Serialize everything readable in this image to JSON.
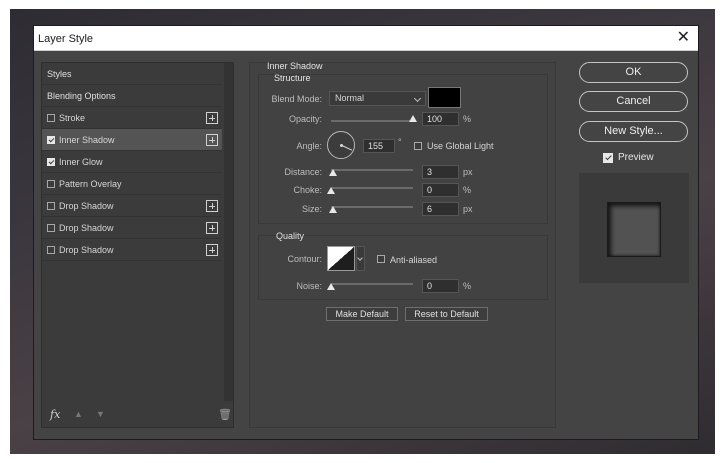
{
  "window": {
    "title": "Layer Style",
    "close_glyph": "✕"
  },
  "styles_list": {
    "items": [
      {
        "label": "Styles",
        "kind": "header",
        "has_checkbox": false,
        "checked": false,
        "has_add": false,
        "selected": false
      },
      {
        "label": "Blending Options",
        "kind": "header",
        "has_checkbox": false,
        "checked": false,
        "has_add": false,
        "selected": false
      },
      {
        "label": "Stroke",
        "kind": "effect",
        "has_checkbox": true,
        "checked": false,
        "has_add": true,
        "selected": false
      },
      {
        "label": "Inner Shadow",
        "kind": "effect",
        "has_checkbox": true,
        "checked": true,
        "has_add": true,
        "selected": true
      },
      {
        "label": "Inner Glow",
        "kind": "effect",
        "has_checkbox": true,
        "checked": true,
        "has_add": false,
        "selected": false
      },
      {
        "label": "Pattern Overlay",
        "kind": "effect",
        "has_checkbox": true,
        "checked": false,
        "has_add": false,
        "selected": false
      },
      {
        "label": "Drop Shadow",
        "kind": "effect",
        "has_checkbox": true,
        "checked": false,
        "has_add": true,
        "selected": false
      },
      {
        "label": "Drop Shadow",
        "kind": "effect",
        "has_checkbox": true,
        "checked": false,
        "has_add": true,
        "selected": false
      },
      {
        "label": "Drop Shadow",
        "kind": "effect",
        "has_checkbox": true,
        "checked": false,
        "has_add": true,
        "selected": false
      }
    ],
    "footer": {
      "fx_label": "fx",
      "move_up_icon": "arrow-up-icon",
      "move_down_icon": "arrow-down-icon",
      "delete_icon": "trash-icon"
    }
  },
  "inner_shadow": {
    "section_title": "Inner Shadow",
    "structure": {
      "title": "Structure",
      "blend_mode": {
        "label": "Blend Mode:",
        "value": "Normal",
        "color": "#000000"
      },
      "opacity": {
        "label": "Opacity:",
        "value": "100",
        "unit": "%",
        "level": 1.0
      },
      "angle": {
        "label": "Angle:",
        "value": "155",
        "unit": "°",
        "use_global_light_label": "Use Global Light",
        "use_global_light": false
      },
      "distance": {
        "label": "Distance:",
        "value": "3",
        "unit": "px",
        "level": 0.02
      },
      "choke": {
        "label": "Choke:",
        "value": "0",
        "unit": "%",
        "level": 0.0
      },
      "size": {
        "label": "Size:",
        "value": "6",
        "unit": "px",
        "level": 0.03
      }
    },
    "quality": {
      "title": "Quality",
      "contour": {
        "label": "Contour:",
        "anti_aliased_label": "Anti-aliased",
        "anti_aliased": false
      },
      "noise": {
        "label": "Noise:",
        "value": "0",
        "unit": "%",
        "level": 0.0
      }
    },
    "make_default_label": "Make Default",
    "reset_default_label": "Reset to Default"
  },
  "actions": {
    "ok_label": "OK",
    "cancel_label": "Cancel",
    "new_style_label": "New Style...",
    "preview_label": "Preview",
    "preview_checked": true
  }
}
